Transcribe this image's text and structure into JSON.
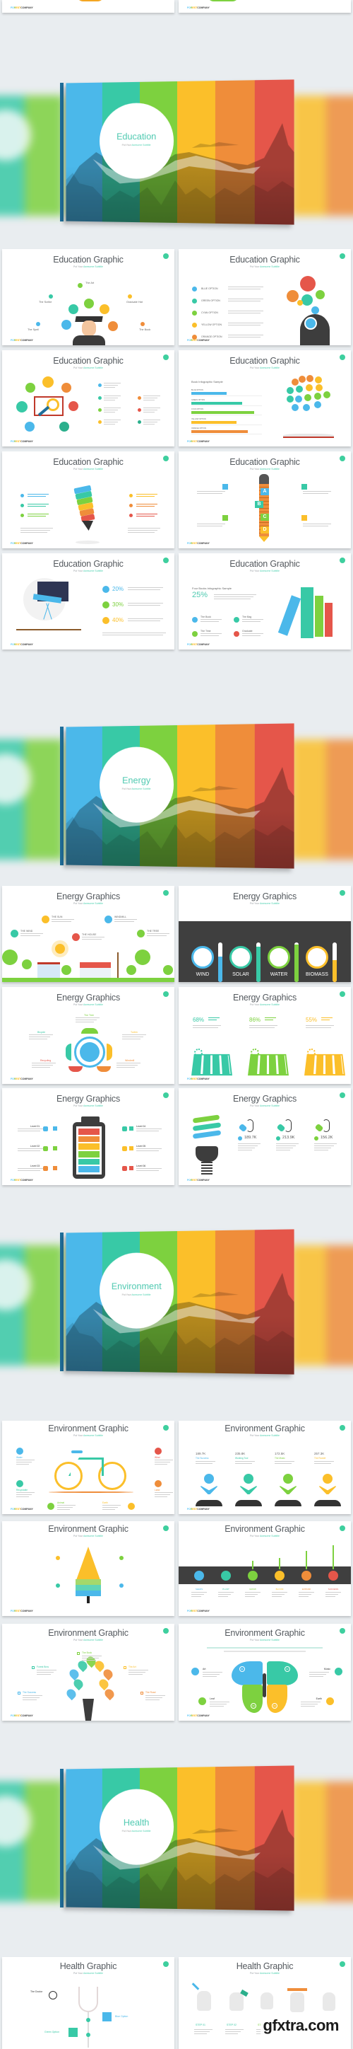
{
  "colors": {
    "stripes": [
      "#4bb8ea",
      "#38c9a6",
      "#7dd13f",
      "#fbbf2a",
      "#ef8d3a",
      "#e5564a"
    ],
    "accent": "#3ecf9e",
    "title_gray": "#555a5f",
    "dark_panel": "#3f3f3f"
  },
  "common": {
    "subtitle_prefix": "Put Your",
    "subtitle_accent": "Awesome Subtitle",
    "brand_parts": [
      "FO",
      "R",
      "EST",
      "COMPANY"
    ]
  },
  "heroes": [
    {
      "title": "Education",
      "subtitle_prefix": "Put Your",
      "subtitle_accent": "Awesome Subtitle"
    },
    {
      "title": "Energy",
      "subtitle_prefix": "Put Your",
      "subtitle_accent": "Awesome Subtitle"
    },
    {
      "title": "Environment",
      "subtitle_prefix": "Put Your",
      "subtitle_accent": "Awesome Subtitle"
    },
    {
      "title": "Health",
      "subtitle_prefix": "Put Your",
      "subtitle_accent": "Awesome Subtitle"
    }
  ],
  "education": {
    "title": "Education Graphic",
    "slide1": {
      "labels": [
        "The Art",
        "The Scribe",
        "Graduate Hat",
        "The Spell",
        "The Book"
      ]
    },
    "slide2": {
      "options": [
        "BLUE OPTION",
        "GREEN OPTION",
        "CYAN OPTION",
        "YELLOW OPTION",
        "ORANGE OPTION"
      ]
    },
    "slide4": {
      "heading": "Book Infographic Sample",
      "bars": [
        {
          "label": "BLUE OPTION",
          "value": 50,
          "color": "#4bb8ea"
        },
        {
          "label": "GREEN OPTION",
          "value": 72,
          "color": "#38c9a6"
        },
        {
          "label": "CYAN OPTION",
          "value": 89,
          "color": "#7dd13f"
        },
        {
          "label": "YELLOW OPTION",
          "value": 64,
          "color": "#fbbf2a"
        },
        {
          "label": "ORANGE OPTION",
          "value": 80,
          "color": "#ef8d3a"
        }
      ]
    },
    "slide6": {
      "letters": [
        "A",
        "B",
        "C",
        "D"
      ]
    },
    "slide7": {
      "percents": [
        "20%",
        "30%",
        "40%"
      ]
    },
    "slide8": {
      "heading": "Four Books Infographic Sample",
      "percent": "25%",
      "items": [
        "The Book",
        "The Bag",
        "The Time",
        "Graduate"
      ]
    }
  },
  "energy": {
    "title": "Energy Graphics",
    "slide1": {
      "items": [
        "THE SUN",
        "WINDMILL",
        "THE WIND",
        "THE HOUSE",
        "THE TREE"
      ]
    },
    "slide2": {
      "items": [
        {
          "label": "WIND",
          "fill": 0.65,
          "color": "#4bb8ea"
        },
        {
          "label": "SOLAR",
          "fill": 0.9,
          "color": "#38c9a6"
        },
        {
          "label": "WATER",
          "fill": 0.95,
          "color": "#7dd13f"
        },
        {
          "label": "BIOMASS",
          "fill": 0.55,
          "color": "#fbbf2a"
        }
      ]
    },
    "slide3": {
      "items": [
        "The Tree",
        "Bicycle",
        "Turbin",
        "Recycling",
        "Windmill"
      ]
    },
    "slide4": {
      "stats": [
        {
          "value": "68%",
          "color": "#38c9a6"
        },
        {
          "value": "86%",
          "color": "#7dd13f"
        },
        {
          "value": "55%",
          "color": "#fbbf2a"
        }
      ]
    },
    "slide5": {
      "levels": [
        "Level 01",
        "Level 02",
        "Level 03",
        "Level 04",
        "Level 05",
        "Level 06"
      ]
    },
    "slide6": {
      "values": [
        "189.7K",
        "213.9K",
        "156.2K"
      ]
    }
  },
  "environment": {
    "title": "Environment Graphic",
    "slide1": {
      "items": [
        "Water",
        "Wind",
        "Recyclable",
        "Land",
        "Animal",
        "Earth"
      ]
    },
    "slide2": {
      "stats": [
        {
          "value": "189.7K",
          "label": "The Success"
        },
        {
          "value": "235.8K",
          "label": "Working Tool"
        },
        {
          "value": "172.5K",
          "label": "The Music"
        },
        {
          "value": "257.3K",
          "label": "The Rocket"
        }
      ]
    },
    "slide4": {
      "steps": [
        "SEEDS",
        "PLANT",
        "GROW",
        "BLOOM",
        "EXPAND",
        "SUCCESS"
      ]
    },
    "slide5": {
      "items": [
        "The Book",
        "Forest Bros",
        "The Art",
        "The Success",
        "The Road"
      ]
    },
    "slide6": {
      "items": [
        "Art",
        "Music",
        "Leaf",
        "Earth"
      ],
      "numbers": [
        "01",
        "02",
        "03",
        "04"
      ]
    }
  },
  "health": {
    "title": "Health Graphic",
    "slide1": {
      "items": [
        "The Doctor",
        "Blue Option",
        "Green Option"
      ]
    },
    "slide2": {
      "steps": [
        "STEP 01",
        "STEP 02",
        "STEP 03"
      ]
    }
  },
  "watermark": "gfxtra.com"
}
